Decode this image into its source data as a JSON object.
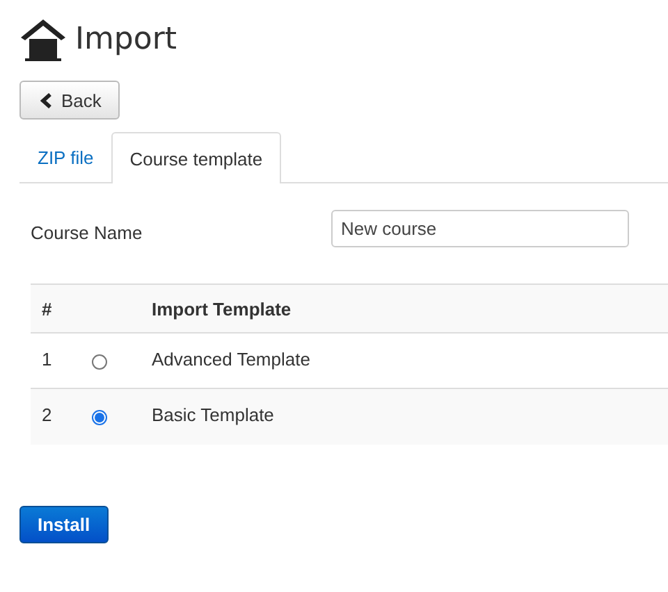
{
  "title": "Import",
  "back_button": "Back",
  "tabs": [
    {
      "label": "ZIP file",
      "selected": false
    },
    {
      "label": "Course template",
      "selected": true
    }
  ],
  "course_name": {
    "label": "Course Name",
    "value": "New course"
  },
  "table": {
    "columns": [
      "#",
      "Import Template"
    ],
    "rows": [
      {
        "number": "1",
        "name": "Advanced Template",
        "selected": false
      },
      {
        "number": "2",
        "name": "Basic Template",
        "selected": true
      }
    ]
  },
  "install_button": "Install"
}
